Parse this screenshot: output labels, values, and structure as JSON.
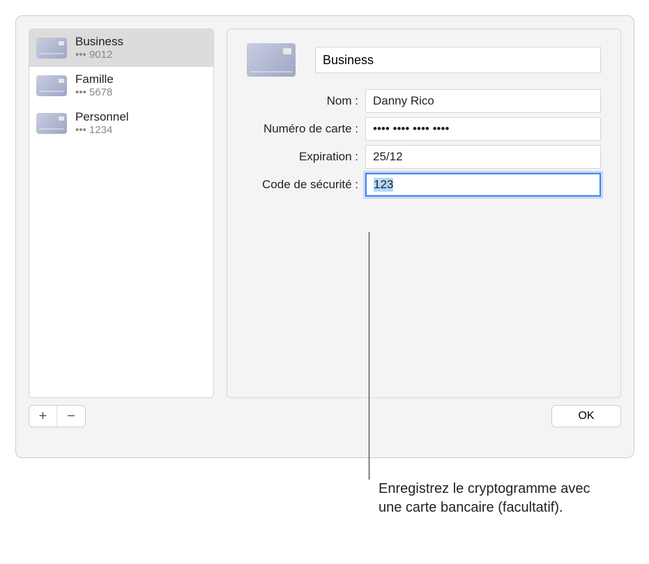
{
  "sidebar": {
    "items": [
      {
        "title": "Business",
        "sub": "••• 9012",
        "selected": true
      },
      {
        "title": "Famille",
        "sub": "••• 5678",
        "selected": false
      },
      {
        "title": "Personnel",
        "sub": "••• 1234",
        "selected": false
      }
    ]
  },
  "detail": {
    "title_value": "Business",
    "fields": {
      "name_label": "Nom :",
      "name_value": "Danny Rico",
      "number_label": "Numéro de carte :",
      "number_value": "•••• •••• •••• ••••",
      "exp_label": "Expiration :",
      "exp_value": "25/12",
      "cvc_label": "Code de sécurité :",
      "cvc_value": "123"
    }
  },
  "buttons": {
    "add": "+",
    "remove": "−",
    "ok": "OK"
  },
  "callout": "Enregistrez le cryptogramme avec une carte bancaire (facultatif)."
}
